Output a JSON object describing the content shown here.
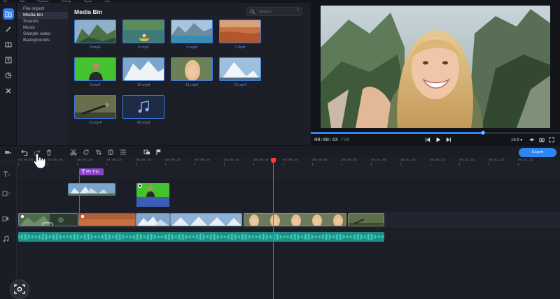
{
  "menu": [
    "File",
    "Edit",
    "Playback",
    "Settings",
    "Export",
    "Help"
  ],
  "categories": [
    {
      "label": "File import"
    },
    {
      "label": "Media bin"
    },
    {
      "label": "Sounds"
    },
    {
      "label": "Music"
    },
    {
      "label": "Sample video"
    },
    {
      "label": "Backgrounds"
    }
  ],
  "media_bin": {
    "title": "Media Bin",
    "search_placeholder": "Search",
    "clips": [
      {
        "name": "4.mp4",
        "scene": "valley"
      },
      {
        "name": "5.mp4",
        "scene": "kayak"
      },
      {
        "name": "6.mp4",
        "scene": "lake"
      },
      {
        "name": "7.mp4",
        "scene": "desert"
      },
      {
        "name": "9.mp4",
        "scene": "greenscreen"
      },
      {
        "name": "10.mp4",
        "scene": "peaks"
      },
      {
        "name": "11.mp4",
        "scene": "selfie"
      },
      {
        "name": "12.mp4",
        "scene": "mountain"
      },
      {
        "name": "13.mp4",
        "scene": "camp"
      },
      {
        "name": "45.mp3",
        "scene": "audio"
      }
    ]
  },
  "preview": {
    "timecode_main": "00:00:43",
    "timecode_ms": ".700",
    "progress_fraction": 0.69,
    "aspect": "16:9 ▾"
  },
  "toolbar": {
    "export_label": "Export"
  },
  "ruler_ticks": [
    "00:00:00",
    "00:00:05",
    "00:00:10",
    "00:00:15",
    "00:00:20",
    "00:00:25",
    "00:00:30",
    "00:00:35",
    "00:00:40",
    "00:00:45",
    "00:00:50",
    "00:00:55",
    "00:01:00",
    "00:01:05",
    "00:01:10",
    "00:01:15",
    "00:01:20",
    "00:01:25"
  ],
  "timeline": {
    "title_clip": "My Trip"
  },
  "colors": {
    "accent": "#2f86f2",
    "playhead": "#ff3b3b",
    "title_clip": "#8a44c9",
    "audio_wave": "#3fd2c0"
  }
}
